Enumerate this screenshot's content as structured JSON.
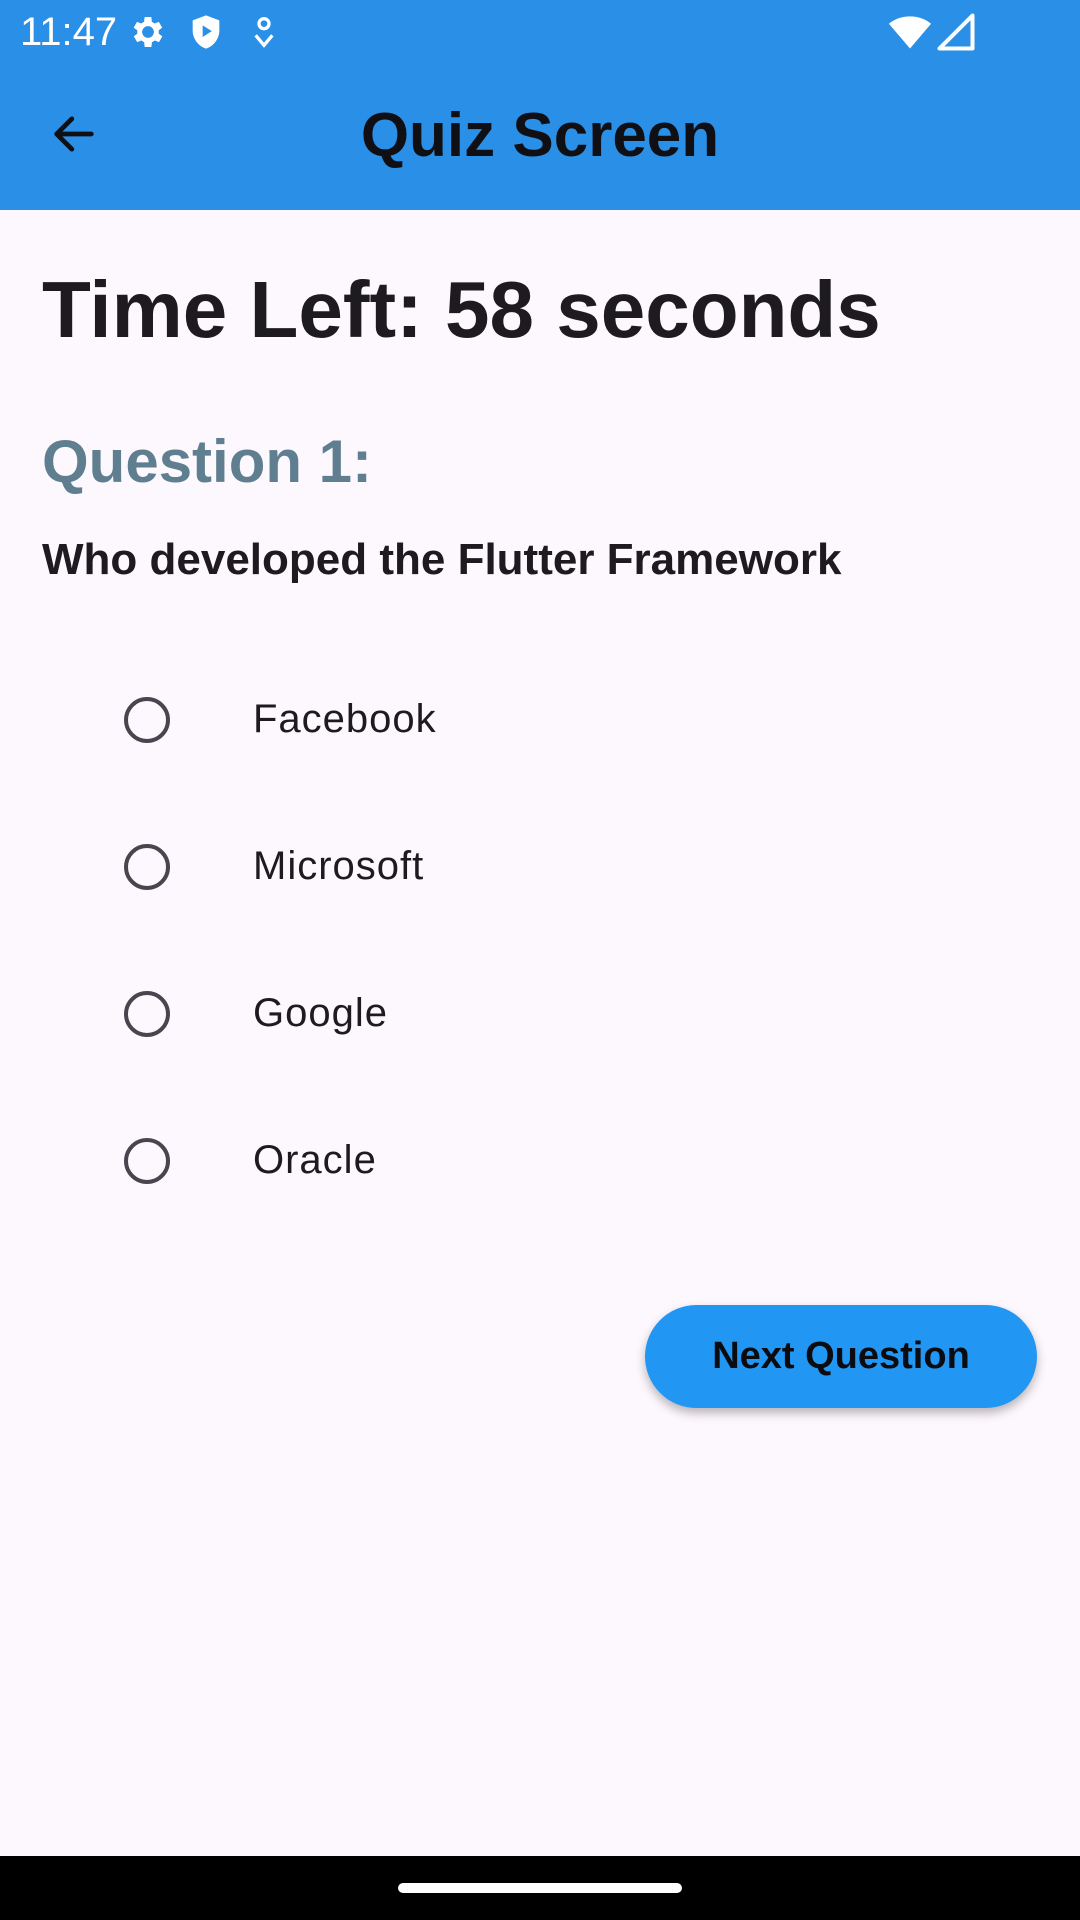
{
  "status_bar": {
    "time": "11:47",
    "icons": [
      "gear-icon",
      "shield-play-icon",
      "location-pin-icon",
      "wifi-icon",
      "cell-signal-icon"
    ]
  },
  "app_bar": {
    "title": "Quiz Screen",
    "back_icon": "arrow-back-icon",
    "background_color": "#2A8FE6"
  },
  "quiz": {
    "timer_text": "Time Left: 58 seconds",
    "question_number": "Question 1:",
    "question_text": "Who developed the Flutter Framework",
    "options": [
      {
        "label": "Facebook",
        "selected": false
      },
      {
        "label": "Microsoft",
        "selected": false
      },
      {
        "label": "Google",
        "selected": false
      },
      {
        "label": "Oracle",
        "selected": false
      }
    ],
    "next_button_label": "Next Question"
  },
  "colors": {
    "accent": "#2196F3",
    "question_number": "#5F7F90",
    "background": "#FDF7FE"
  }
}
